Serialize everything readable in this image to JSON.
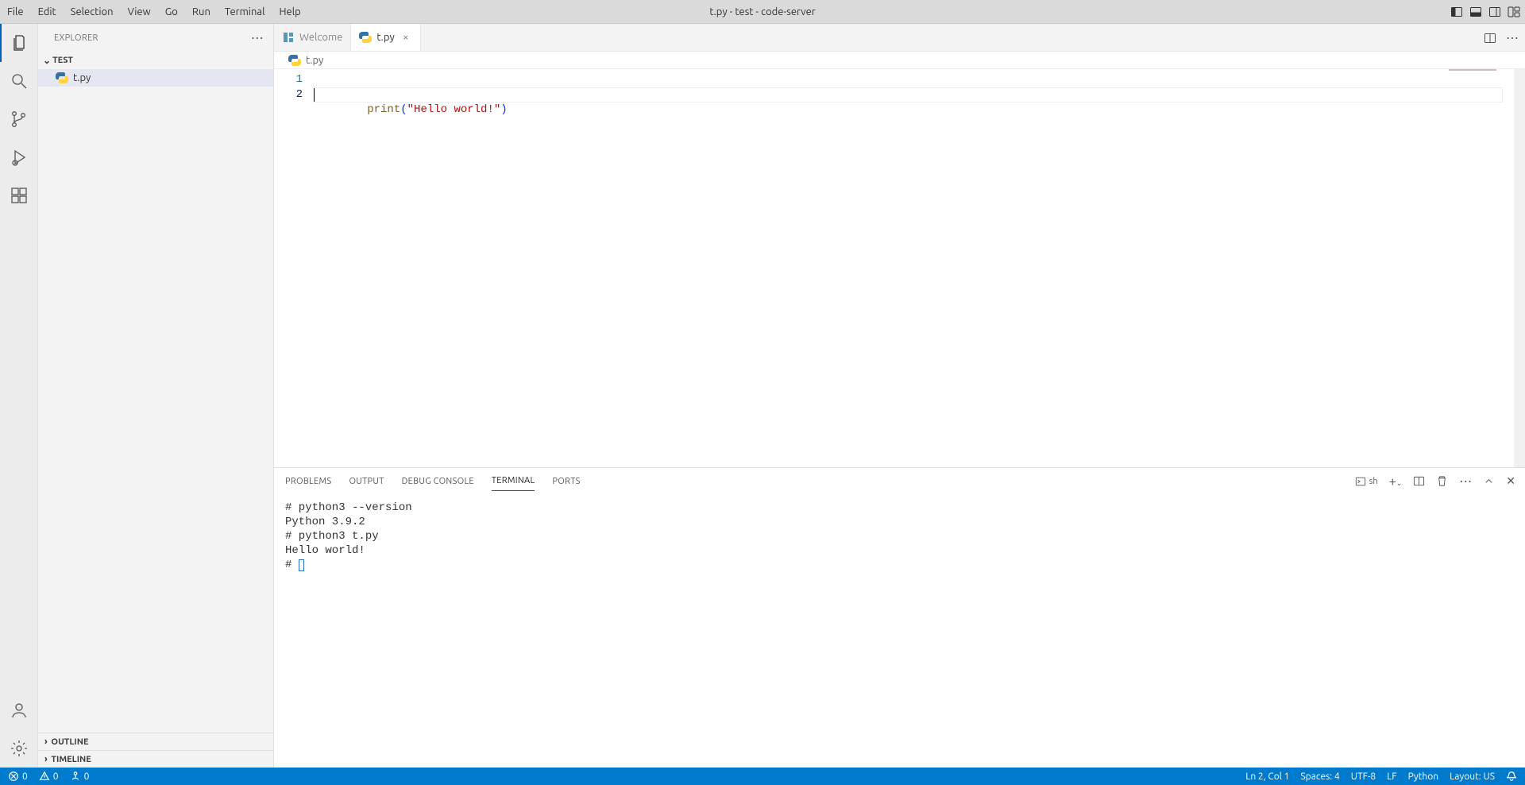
{
  "menubar": {
    "items": [
      "File",
      "Edit",
      "Selection",
      "View",
      "Go",
      "Run",
      "Terminal",
      "Help"
    ],
    "title": "t.py - test - code-server"
  },
  "activity": {
    "explorer": "Explorer",
    "search": "Search",
    "scm": "Source Control",
    "debug": "Run and Debug",
    "extensions": "Extensions",
    "account": "Accounts",
    "settings": "Manage"
  },
  "sidebar": {
    "title": "EXPLORER",
    "section": "TEST",
    "files": [
      {
        "name": "t.py"
      }
    ],
    "outline": "OUTLINE",
    "timeline": "TIMELINE"
  },
  "tabs": {
    "items": [
      {
        "label": "Welcome",
        "active": false
      },
      {
        "label": "t.py",
        "active": true
      }
    ]
  },
  "breadcrumb": {
    "file": "t.py"
  },
  "editor": {
    "lines": [
      {
        "n": "1"
      },
      {
        "n": "2"
      }
    ],
    "code": {
      "fn": "print",
      "open": "(",
      "str": "\"Hello world!\"",
      "close": ")"
    }
  },
  "panel": {
    "tabs": [
      "PROBLEMS",
      "OUTPUT",
      "DEBUG CONSOLE",
      "TERMINAL",
      "PORTS"
    ],
    "active": "TERMINAL",
    "shell_label": "sh",
    "terminal_lines": [
      "# python3 --version",
      "Python 3.9.2",
      "# python3 t.py",
      "Hello world!",
      "# "
    ]
  },
  "status": {
    "errors": "0",
    "warnings": "0",
    "ports": "0",
    "ln_col": "Ln 2, Col 1",
    "spaces": "Spaces: 4",
    "encoding": "UTF-8",
    "eol": "LF",
    "lang": "Python",
    "layout": "Layout: US"
  }
}
